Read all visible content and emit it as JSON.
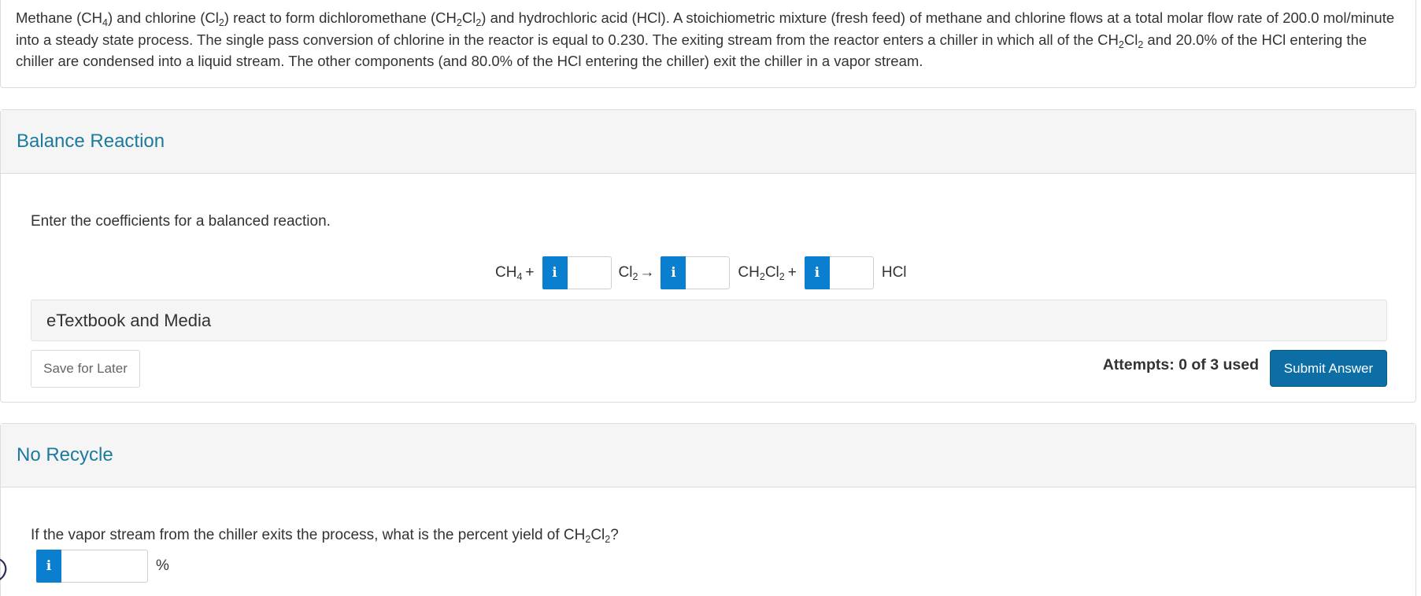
{
  "problem": {
    "part1": "Methane (CH",
    "sub1": "4",
    "part2": ") and chlorine (Cl",
    "sub2": "2",
    "part3": ") react to form dichloromethane (CH",
    "sub3": "2",
    "part4": "Cl",
    "sub4": "2",
    "part5": ") and hydrochloric acid (HCl).  A stoichiometric mixture (fresh feed) of methane and chlorine flows at a total molar flow rate of 200.0 mol/minute into a steady state process.  The single pass conversion of chlorine in the reactor is equal to 0.230.  The exiting stream from the reactor enters a chiller in which all of the CH",
    "sub5": "2",
    "part6": "Cl",
    "sub6": "2",
    "part7": " and 20.0% of the HCl entering the chiller are condensed into a liquid stream.  The other components (and 80.0% of the HCl entering the chiller) exit the chiller in a vapor stream."
  },
  "balance_reaction": {
    "title": "Balance Reaction",
    "prompt": "Enter the coefficients for a balanced reaction.",
    "equation": {
      "ch4_main": "CH",
      "ch4_sub": "4",
      "plus1": "+",
      "cl2_main": "Cl",
      "cl2_sub": "2",
      "arrow": "→",
      "ch2cl2_a": "CH",
      "ch2cl2_sub_a": "2",
      "ch2cl2_b": "Cl",
      "ch2cl2_sub_b": "2",
      "plus2": "+",
      "hcl": "HCl"
    },
    "info_icon": "i",
    "inputs": [
      "",
      "",
      ""
    ],
    "etextbook_label": "eTextbook and Media",
    "save_label": "Save for Later",
    "attempts": "Attempts: 0 of 3 used",
    "submit_label": "Submit Answer",
    "accent_color": "#1b7a9e",
    "button_color": "#0c6ea4",
    "info_color": "#0a7fcf"
  },
  "no_recycle": {
    "title": "No Recycle",
    "prompt_main": "If the vapor stream from the chiller exits the process, what is the percent yield of CH",
    "prompt_sub1": "2",
    "prompt_mid": "Cl",
    "prompt_sub2": "2",
    "prompt_end": "?",
    "info_icon": "i",
    "input_value": "",
    "unit": "%"
  }
}
